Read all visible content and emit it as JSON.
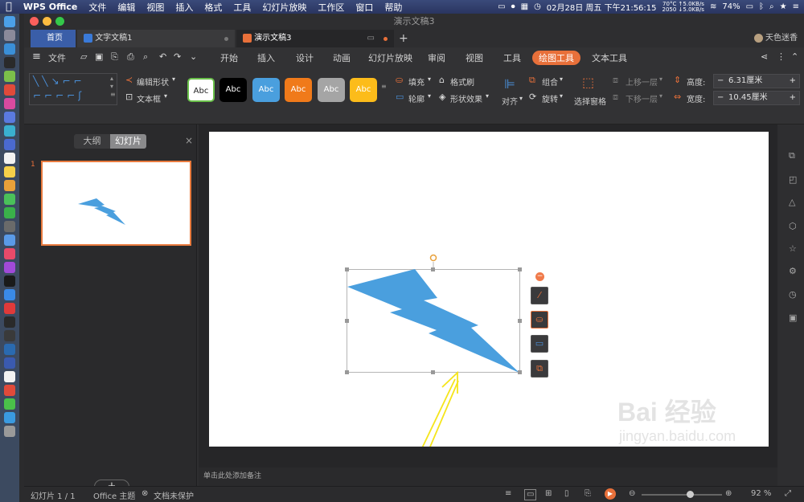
{
  "menubar": {
    "app_name": "WPS Office",
    "menus": [
      "文件",
      "编辑",
      "视图",
      "插入",
      "格式",
      "工具",
      "幻灯片放映",
      "工作区",
      "窗口",
      "帮助"
    ],
    "sensor_top": "70°C ↑5.0KB/s",
    "sensor_bottom": "2050 ↓5.0KB/s",
    "datetime": "02月28日 周五 下午21:56:15",
    "battery": "74%"
  },
  "window": {
    "title": "演示文稿3",
    "tabs": [
      "首页",
      "文字文稿1",
      "演示文稿3"
    ],
    "user": "天色迷香"
  },
  "menu_row": {
    "file": "文件",
    "tabs": [
      "开始",
      "插入",
      "设计",
      "动画",
      "幻灯片放映",
      "审阅",
      "视图",
      "工具",
      "绘图工具",
      "文本工具"
    ],
    "active_tab": "绘图工具"
  },
  "ribbon": {
    "edit_shape": "编辑形状",
    "textbox": "文本框",
    "style_label": "Abc",
    "fill": "填充",
    "outline": "轮廓",
    "format_painter": "格式刷",
    "shape_effects": "形状效果",
    "align": "对齐",
    "group": "组合",
    "rotate": "旋转",
    "selection_pane": "选择窗格",
    "bring_forward": "上移一层",
    "send_backward": "下移一层",
    "height_label": "高度:",
    "height_value": "6.31厘米",
    "width_label": "宽度:",
    "width_value": "10.45厘米",
    "minus": "−",
    "plus": "+"
  },
  "left_panel": {
    "outline_tab": "大纲",
    "slides_tab": "幻灯片",
    "close": "×",
    "slide_number": "1",
    "add": "+"
  },
  "notes": {
    "placeholder": "单击此处添加备注"
  },
  "status": {
    "slide_counter": "幻灯片 1 / 1",
    "theme": "Office 主题",
    "protection": "文档未保护",
    "zoom": "92 %",
    "zoom_level": 0.6
  },
  "watermark": {
    "brand": "Bai 经验",
    "url": "jingyan.baidu.com"
  },
  "colors": {
    "accent": "#e8703a",
    "shape_fill": "#4a9fde",
    "annotation_arrow": "#f5e51a"
  }
}
